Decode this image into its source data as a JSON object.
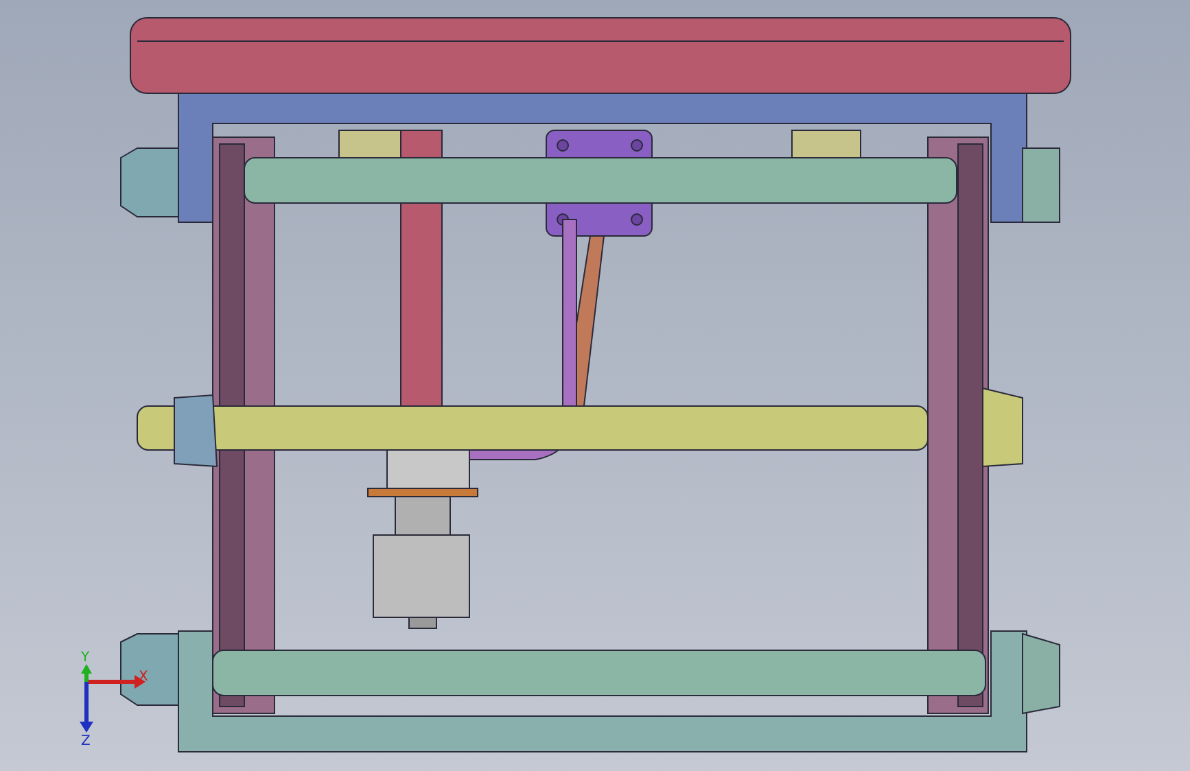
{
  "viewport": {
    "triad": [
      {
        "kind": "x",
        "label": "X"
      },
      {
        "kind": "y",
        "label": "Y"
      },
      {
        "kind": "z",
        "label": "Z"
      }
    ]
  }
}
